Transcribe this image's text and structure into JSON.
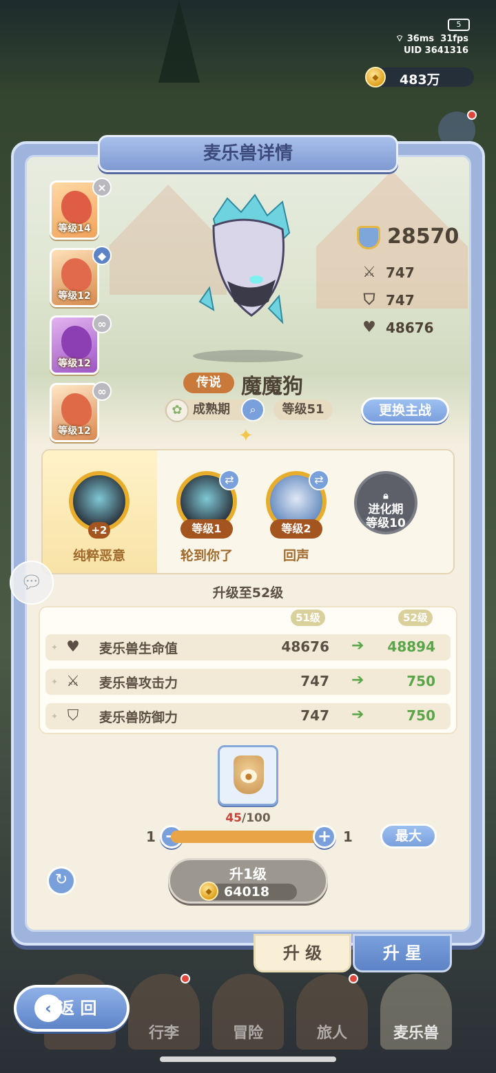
{
  "hud": {
    "battery": "5",
    "ping": "36ms",
    "fps": "31fps",
    "uid": "UID 3641316",
    "gold": "483万"
  },
  "panel": {
    "title": "麦乐兽详情"
  },
  "roster": [
    {
      "level": "等级14",
      "badge": "×"
    },
    {
      "level": "等级12",
      "badge": "◆"
    },
    {
      "level": "等级12",
      "badge": "∞"
    },
    {
      "level": "等级12",
      "badge": "∞"
    }
  ],
  "stats": {
    "power": "28570",
    "attack": "747",
    "defense": "747",
    "hp": "48676"
  },
  "monster": {
    "rarity": "传说",
    "name": "魔魔狗",
    "stage": "成熟期",
    "level": "等级51",
    "switch_label": "更换主战"
  },
  "skills": [
    {
      "name": "纯粹恶意",
      "extra": "+2"
    },
    {
      "name": "轮到你了",
      "level": "等级1"
    },
    {
      "name": "回声",
      "level": "等级2"
    }
  ],
  "locked_skill": {
    "line1": "进化期",
    "line2": "等级10"
  },
  "upgrade": {
    "title": "升级至52级",
    "from_level": "51级",
    "to_level": "52级",
    "rows": [
      {
        "label": "麦乐兽生命值",
        "old": "48676",
        "new": "48894",
        "icon": "heart-icon"
      },
      {
        "label": "麦乐兽攻击力",
        "old": "747",
        "new": "750",
        "icon": "swords-icon"
      },
      {
        "label": "麦乐兽防御力",
        "old": "747",
        "new": "750",
        "icon": "shield-icon"
      }
    ],
    "material_have": "45",
    "material_need": "/100",
    "qty_min": "1",
    "qty_current": "1",
    "slider_fraction": 1.0,
    "max_label": "最大",
    "button_label": "升1级",
    "cost": "64018"
  },
  "tabs": {
    "level": "升 级",
    "star": "升 星"
  },
  "nav": {
    "back": "返 回",
    "items": [
      "行李",
      "冒险",
      "旅人",
      "麦乐兽"
    ]
  },
  "colors": {
    "accent": "#7aa0dc",
    "gain": "#5aa54a",
    "rarity": "#c97a3a"
  }
}
